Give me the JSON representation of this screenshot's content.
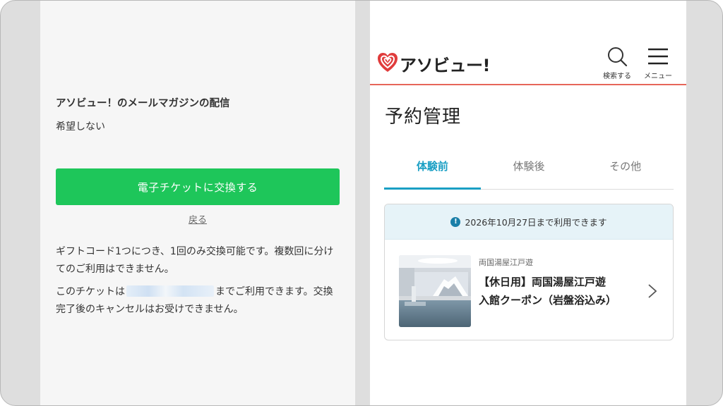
{
  "left_panel": {
    "mail_magazine_label": "アソビュー！のメールマガジンの配信",
    "mail_magazine_value": "希望しない",
    "exchange_button": "電子チケットに交換する",
    "back_link": "戻る",
    "note1": "ギフトコード1つにつき、1回のみ交換可能です。複数回に分けてのご利用はできません。",
    "note2_prefix": "このチケットは",
    "note2_suffix": "までご利用できます。交換完了後のキャンセルはお受けできません。"
  },
  "right_panel": {
    "logo_text": "アソビュー!",
    "search_label": "検索する",
    "menu_label": "メニュー",
    "page_title": "予約管理",
    "tabs": [
      {
        "label": "体験前",
        "active": true
      },
      {
        "label": "体験後",
        "active": false
      },
      {
        "label": "その他",
        "active": false
      }
    ],
    "card": {
      "banner_text": "2026年10月27日まで利用できます",
      "facility": "両国湯屋江戸遊",
      "title_line1": "【休日用】両国湯屋江戸遊",
      "title_line2": "入館クーポン（岩盤浴込み）"
    }
  },
  "colors": {
    "accent_green": "#1ec65a",
    "accent_blue": "#1a9fc4",
    "brand_red": "#e03c3c",
    "header_rule": "#e6665a"
  }
}
